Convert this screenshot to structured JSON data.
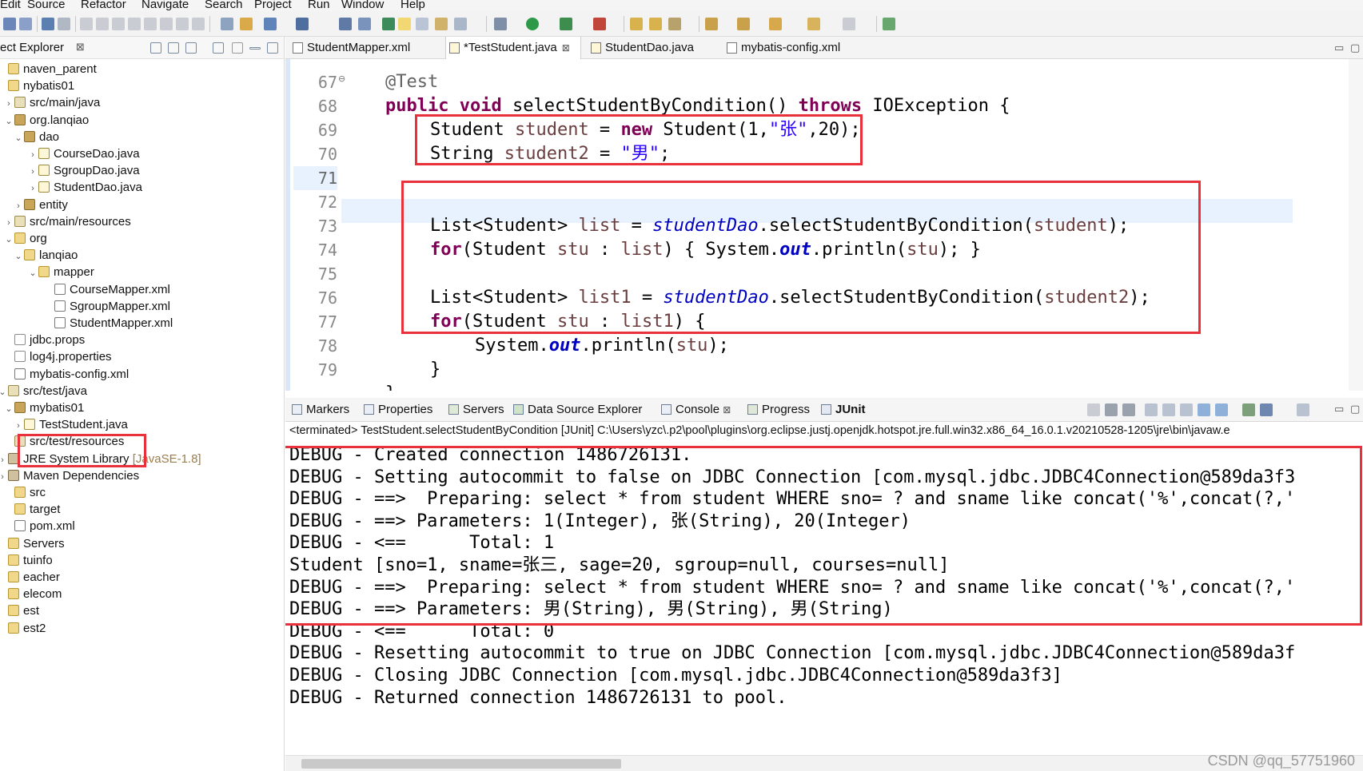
{
  "menu": [
    "Edit",
    "Source",
    "Refactor",
    "Navigate",
    "Search",
    "Project",
    "Run",
    "Window",
    "Help"
  ],
  "explorer": {
    "title": "ect Explorer",
    "close_glyph": "⊠",
    "items": [
      {
        "label": "naven_parent",
        "icon": "project-icon"
      },
      {
        "label": "nybatis01",
        "icon": "project-icon"
      },
      {
        "label": "src/main/java",
        "icon": "source-folder-icon"
      },
      {
        "label": "org.lanqiao",
        "icon": "package-icon"
      },
      {
        "label": "dao",
        "icon": "package-icon"
      },
      {
        "label": "CourseDao.java",
        "icon": "java-file-icon"
      },
      {
        "label": "SgroupDao.java",
        "icon": "java-file-icon"
      },
      {
        "label": "StudentDao.java",
        "icon": "java-file-icon"
      },
      {
        "label": "entity",
        "icon": "package-icon"
      },
      {
        "label": "src/main/resources",
        "icon": "source-folder-icon"
      },
      {
        "label": "org",
        "icon": "folder-icon"
      },
      {
        "label": "lanqiao",
        "icon": "folder-icon"
      },
      {
        "label": "mapper",
        "icon": "folder-icon"
      },
      {
        "label": "CourseMapper.xml",
        "icon": "xml-file-icon"
      },
      {
        "label": "SgroupMapper.xml",
        "icon": "xml-file-icon"
      },
      {
        "label": "StudentMapper.xml",
        "icon": "xml-file-icon"
      },
      {
        "label": "jdbc.props",
        "icon": "file-icon"
      },
      {
        "label": "log4j.properties",
        "icon": "file-icon"
      },
      {
        "label": "mybatis-config.xml",
        "icon": "xml-file-icon"
      },
      {
        "label": "src/test/java",
        "icon": "source-folder-icon"
      },
      {
        "label": "mybatis01",
        "icon": "package-icon"
      },
      {
        "label": "TestStudent.java",
        "icon": "java-file-icon"
      },
      {
        "label": "src/test/resources",
        "icon": "source-folder-icon"
      },
      {
        "label": "JRE System Library",
        "suffix": "[JavaSE-1.8]",
        "icon": "library-icon"
      },
      {
        "label": "Maven Dependencies",
        "icon": "library-icon"
      },
      {
        "label": "src",
        "icon": "folder-icon"
      },
      {
        "label": "target",
        "icon": "folder-icon"
      },
      {
        "label": "pom.xml",
        "icon": "xml-file-icon"
      },
      {
        "label": "Servers",
        "icon": "project-icon"
      },
      {
        "label": "tuinfo",
        "icon": "project-icon"
      },
      {
        "label": "eacher",
        "icon": "project-icon"
      },
      {
        "label": "elecom",
        "icon": "project-icon"
      },
      {
        "label": "est",
        "icon": "project-icon"
      },
      {
        "label": "est2",
        "icon": "project-icon"
      }
    ]
  },
  "editor": {
    "tabs": [
      {
        "label": "StudentMapper.xml",
        "active": false
      },
      {
        "label": "*TestStudent.java",
        "active": true
      },
      {
        "label": "StudentDao.java",
        "active": false
      },
      {
        "label": "mybatis-config.xml",
        "active": false
      }
    ],
    "lines": [
      {
        "num": "67",
        "marker": "⊖"
      },
      {
        "num": "68"
      },
      {
        "num": "69"
      },
      {
        "num": "70"
      },
      {
        "num": "71"
      },
      {
        "num": "72"
      },
      {
        "num": "73"
      },
      {
        "num": "74"
      },
      {
        "num": "75"
      },
      {
        "num": "76"
      },
      {
        "num": "77"
      },
      {
        "num": "78"
      },
      {
        "num": "79"
      }
    ],
    "code": {
      "l67_ann": "@Test",
      "l68_kw1": "public",
      "l68_kw2": "void",
      "l68_method": "selectStudentByCondition()",
      "l68_throws": "throws",
      "l68_exc": "IOException {",
      "l69_type": "Student",
      "l69_var": "student",
      "l69_eq": " = ",
      "l69_new": "new",
      "l69_ctor": " Student(1,",
      "l69_str": "\"张\"",
      "l69_rest": ",20);",
      "l70_type": "String",
      "l70_var": "student2",
      "l70_eq": " = ",
      "l70_str": "\"男\"",
      "l70_rest": ";",
      "l72_type": "List<Student>",
      "l72_var": "list",
      "l72_eq": " = ",
      "l72_fld": "studentDao",
      "l72_call": ".selectStudentByCondition(",
      "l72_arg": "student",
      "l72_end": ");",
      "l73_for": "for",
      "l73_a": "(Student ",
      "l73_var": "stu",
      "l73_b": " : ",
      "l73_list": "list",
      "l73_c": ") { System.",
      "l73_out": "out",
      "l73_d": ".println(",
      "l73_arg": "stu",
      "l73_e": "); }",
      "l75_type": "List<Student>",
      "l75_var": "list1",
      "l75_eq": " = ",
      "l75_fld": "studentDao",
      "l75_call": ".selectStudentByCondition(",
      "l75_arg": "student2",
      "l75_end": ");",
      "l76_for": "for",
      "l76_a": "(Student ",
      "l76_var": "stu",
      "l76_b": " : ",
      "l76_list": "list1",
      "l76_c": ") {",
      "l77_a": "System.",
      "l77_out": "out",
      "l77_b": ".println(",
      "l77_arg": "stu",
      "l77_c": ");",
      "l78": "}",
      "l79": "}"
    }
  },
  "panel": {
    "tabs": [
      "Markers",
      "Properties",
      "Servers",
      "Data Source Explorer",
      "Console",
      "Progress",
      "JUnit"
    ],
    "console_close": "⊠",
    "terminated": "<terminated> TestStudent.selectStudentByCondition [JUnit] C:\\Users\\yzc\\.p2\\pool\\plugins\\org.eclipse.justj.openjdk.hotspot.jre.full.win32.x86_64_16.0.1.v20210528-1205\\jre\\bin\\javaw.e",
    "console_lines": [
      "DEBUG - Created connection 1486726131.",
      "DEBUG - Setting autocommit to false on JDBC Connection [com.mysql.jdbc.JDBC4Connection@589da3f3",
      "DEBUG - ==>  Preparing: select * from student WHERE sno= ? and sname like concat('%',concat(?,'",
      "DEBUG - ==> Parameters: 1(Integer), 张(String), 20(Integer)",
      "DEBUG - <==      Total: 1",
      "Student [sno=1, sname=张三, sage=20, sgroup=null, courses=null]",
      "DEBUG - ==>  Preparing: select * from student WHERE sno= ? and sname like concat('%',concat(?,'",
      "DEBUG - ==> Parameters: 男(String), 男(String), 男(String)",
      "DEBUG - <==      Total: 0",
      "DEBUG - Resetting autocommit to true on JDBC Connection [com.mysql.jdbc.JDBC4Connection@589da3f",
      "DEBUG - Closing JDBC Connection [com.mysql.jdbc.JDBC4Connection@589da3f3]",
      "DEBUG - Returned connection 1486726131 to pool."
    ]
  },
  "watermark": "CSDN @qq_57751960",
  "colors": {
    "highlight_red": "#e8313a",
    "keyword": "#7f0055",
    "string": "#2a00ff",
    "field": "#0000c0"
  }
}
